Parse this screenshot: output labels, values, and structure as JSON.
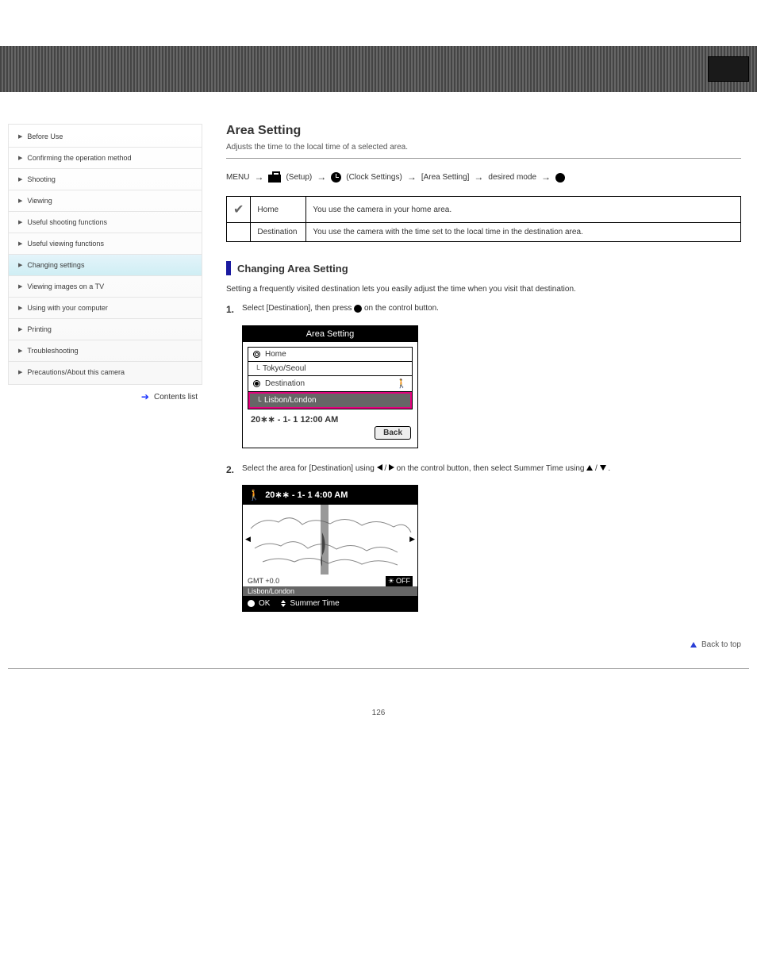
{
  "header": {
    "banner_label": ""
  },
  "sidebar": {
    "items": [
      {
        "label": "Before Use"
      },
      {
        "label": "Confirming the operation method"
      },
      {
        "label": "Shooting"
      },
      {
        "label": "Viewing"
      },
      {
        "label": "Useful shooting functions"
      },
      {
        "label": "Useful viewing functions"
      },
      {
        "label": "Changing settings"
      },
      {
        "label": "Viewing images on a TV"
      },
      {
        "label": "Using with your computer"
      },
      {
        "label": "Printing"
      },
      {
        "label": "Troubleshooting"
      },
      {
        "label": "Precautions/About this camera"
      }
    ],
    "continued": "Contents list"
  },
  "main": {
    "title": "Area Setting",
    "subtitle": "Adjusts the time to the local time of a selected area.",
    "menu_path": {
      "prefix": "MENU",
      "setup_label": "(Setup)",
      "clock_label": "(Clock Settings)",
      "item": "[Area Setting]",
      "mode": "desired mode"
    },
    "options": [
      {
        "check": true,
        "name": "Home",
        "desc": "You use the camera in your home area."
      },
      {
        "check": false,
        "name": "Destination",
        "desc": "You use the camera with the time set to the local time in the destination area."
      }
    ],
    "section_title": "Changing Area Setting",
    "section_intro": "Setting a frequently visited destination lets you easily adjust the time when you visit that destination.",
    "steps": {
      "s1": {
        "text_a": "Select [Destination], then press",
        "text_b": "on the control button."
      },
      "s2": {
        "text_a": "Select the area for [Destination] using",
        "text_mid": "on the control button, then select Summer Time using",
        "text_b": "."
      }
    },
    "lcd1": {
      "title": "Area Setting",
      "home": "Home",
      "home_loc": "Tokyo/Seoul",
      "destination": "Destination",
      "dest_loc": "Lisbon/London",
      "datetime": "20∗∗ -  1-  1 12:00 AM",
      "back": "Back"
    },
    "lcd2": {
      "top_time": "20∗∗ -  1-  1   4:00 AM",
      "gmt": "GMT +0.0",
      "sun_off": "OFF",
      "loc": "Lisbon/London",
      "ok": "OK",
      "summer": "Summer Time"
    },
    "back_to_top": "Back to top"
  },
  "page_number": "126"
}
